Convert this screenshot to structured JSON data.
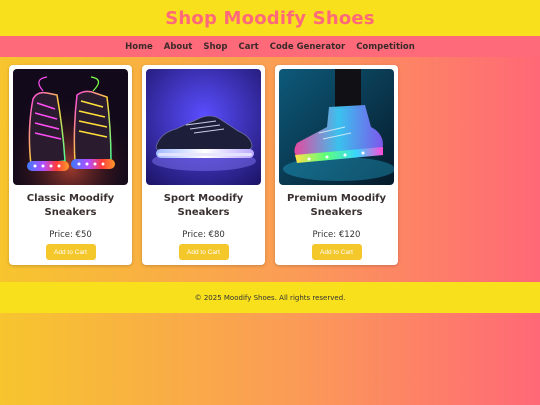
{
  "header": {
    "title": "Shop Moodify Shoes"
  },
  "nav": {
    "items": [
      {
        "label": "Home"
      },
      {
        "label": "About"
      },
      {
        "label": "Shop"
      },
      {
        "label": "Cart"
      },
      {
        "label": "Code Generator"
      },
      {
        "label": "Competition"
      }
    ]
  },
  "products": [
    {
      "name": "Classic Moodify Sneakers",
      "price": "Price: €50",
      "button": "Add to Cart",
      "image": "neon-high-top-sneakers-photo"
    },
    {
      "name": "Sport Moodify Sneakers",
      "price": "Price: €80",
      "button": "Add to Cart",
      "image": "led-sport-sneaker-photo"
    },
    {
      "name": "Premium Moodify Sneakers",
      "price": "Price: €120",
      "button": "Add to Cart",
      "image": "glowing-sneaker-on-foot-photo"
    }
  ],
  "footer": {
    "text": "© 2025 Moodify Shoes. All rights reserved."
  },
  "colors": {
    "header_bg": "#f8e01c",
    "nav_bg": "#ff6a7a",
    "title_color": "#ff6a7a",
    "button_bg": "#f4c72b",
    "gradient_start": "#f7c52e",
    "gradient_end": "#ff6876"
  }
}
